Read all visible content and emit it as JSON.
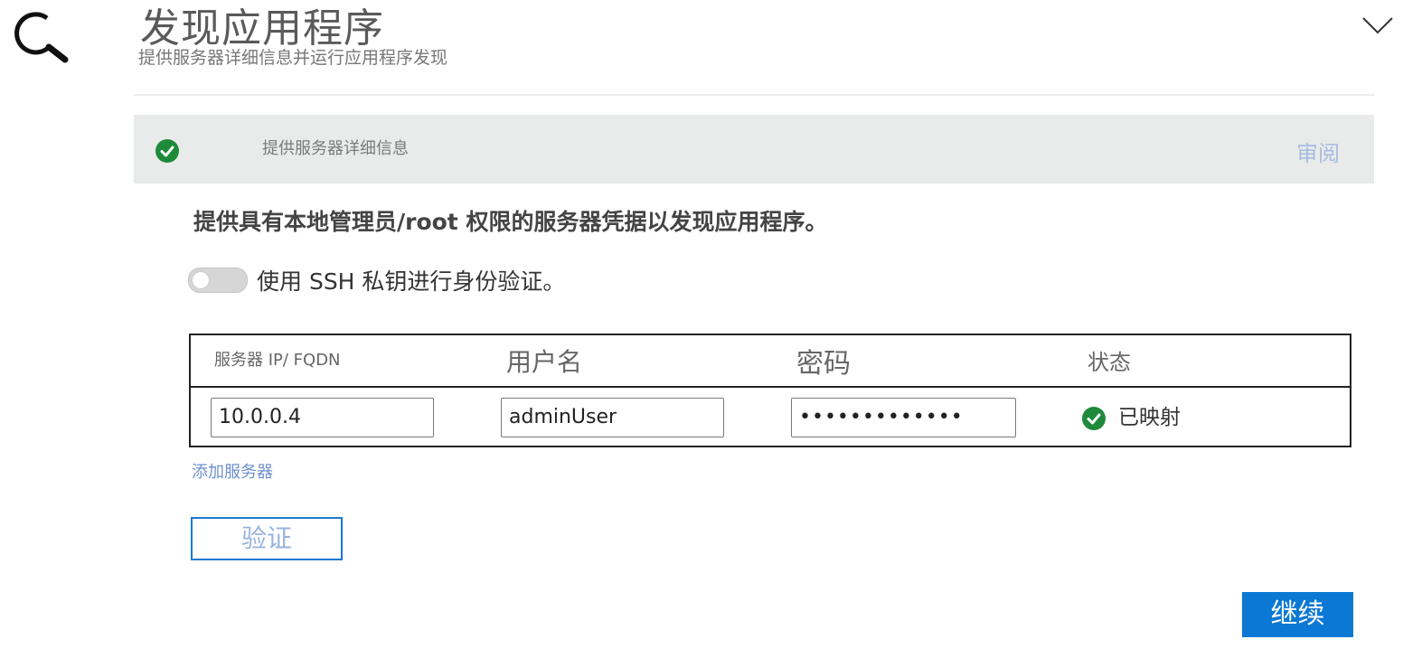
{
  "header": {
    "title": "发现应用程序",
    "subtitle": "提供服务器详细信息并运行应用程序发现",
    "search_icon": "magnifier-icon",
    "collapse_icon": "chevron-down-icon"
  },
  "step": {
    "label": "提供服务器详细信息",
    "review_link": "审阅",
    "status_icon": "check-circle-icon"
  },
  "form": {
    "instruction": "提供具有本地管理员/root 权限的服务器凭据以发现应用程序。",
    "ssh_toggle_label": "使用 SSH 私钥进行身份验证。",
    "ssh_toggle_on": false
  },
  "table": {
    "headers": {
      "server": "服务器 IP/ FQDN",
      "username": "用户名",
      "password": "密码",
      "status": "状态"
    },
    "rows": [
      {
        "server": "10.0.0.4",
        "username": "adminUser",
        "password": "•••••••••••••",
        "status": "已映射"
      }
    ]
  },
  "actions": {
    "add_server": "添加服务器",
    "validate": "验证",
    "continue": "继续"
  },
  "colors": {
    "success_green": "#1e8a3a",
    "primary_blue": "#0a78d4",
    "link_blue": "#6e91cc",
    "banner_bg": "#e8ebe9"
  }
}
